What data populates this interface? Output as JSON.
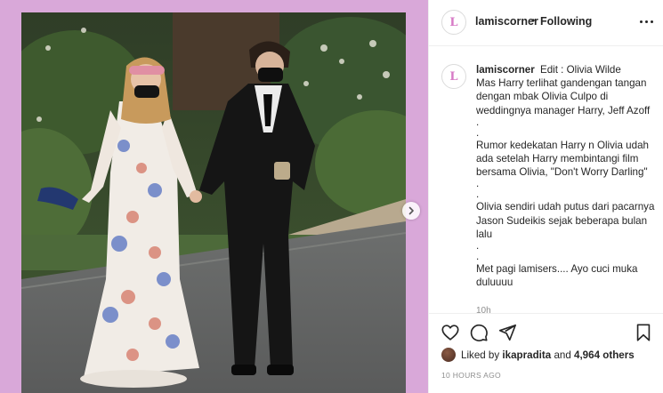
{
  "post": {
    "username": "lamiscorner",
    "separator": "•",
    "follow_state": "Following",
    "avatar_letter": "L",
    "more_icon": "more-horizontal-icon",
    "next_icon": "chevron-right-icon"
  },
  "caption": {
    "username": "lamiscorner",
    "lines": [
      "Edit : Olivia Wilde",
      "Mas Harry terlihat gandengan tangan dengan mbak Olivia Culpo di weddingnya manager Harry, Jeff Azoff",
      ".",
      ".",
      "Rumor kedekatan Harry n Olivia udah ada setelah Harry membintangi film bersama Olivia, \"Don't Worry Darling\"",
      ".",
      ".",
      "Olivia sendiri udah putus dari pacarnya Jason Sudeikis sejak beberapa bulan lalu",
      ".",
      ".",
      "Met pagi lamisers.... Ayo cuci muka duluuuu"
    ],
    "time_ago": "10h"
  },
  "actions": {
    "like_icon": "heart-icon",
    "comment_icon": "comment-icon",
    "share_icon": "share-icon",
    "save_icon": "bookmark-icon"
  },
  "likes": {
    "prefix": "Liked by",
    "liker": "ikapradita",
    "conjunction": "and",
    "count": "4,964 others"
  },
  "date_text": "10 HOURS AGO",
  "colors": {
    "media_background": "#d9a8d9",
    "brand_pink": "#d77ac6",
    "text": "#262626",
    "muted": "#8e8e8e"
  }
}
